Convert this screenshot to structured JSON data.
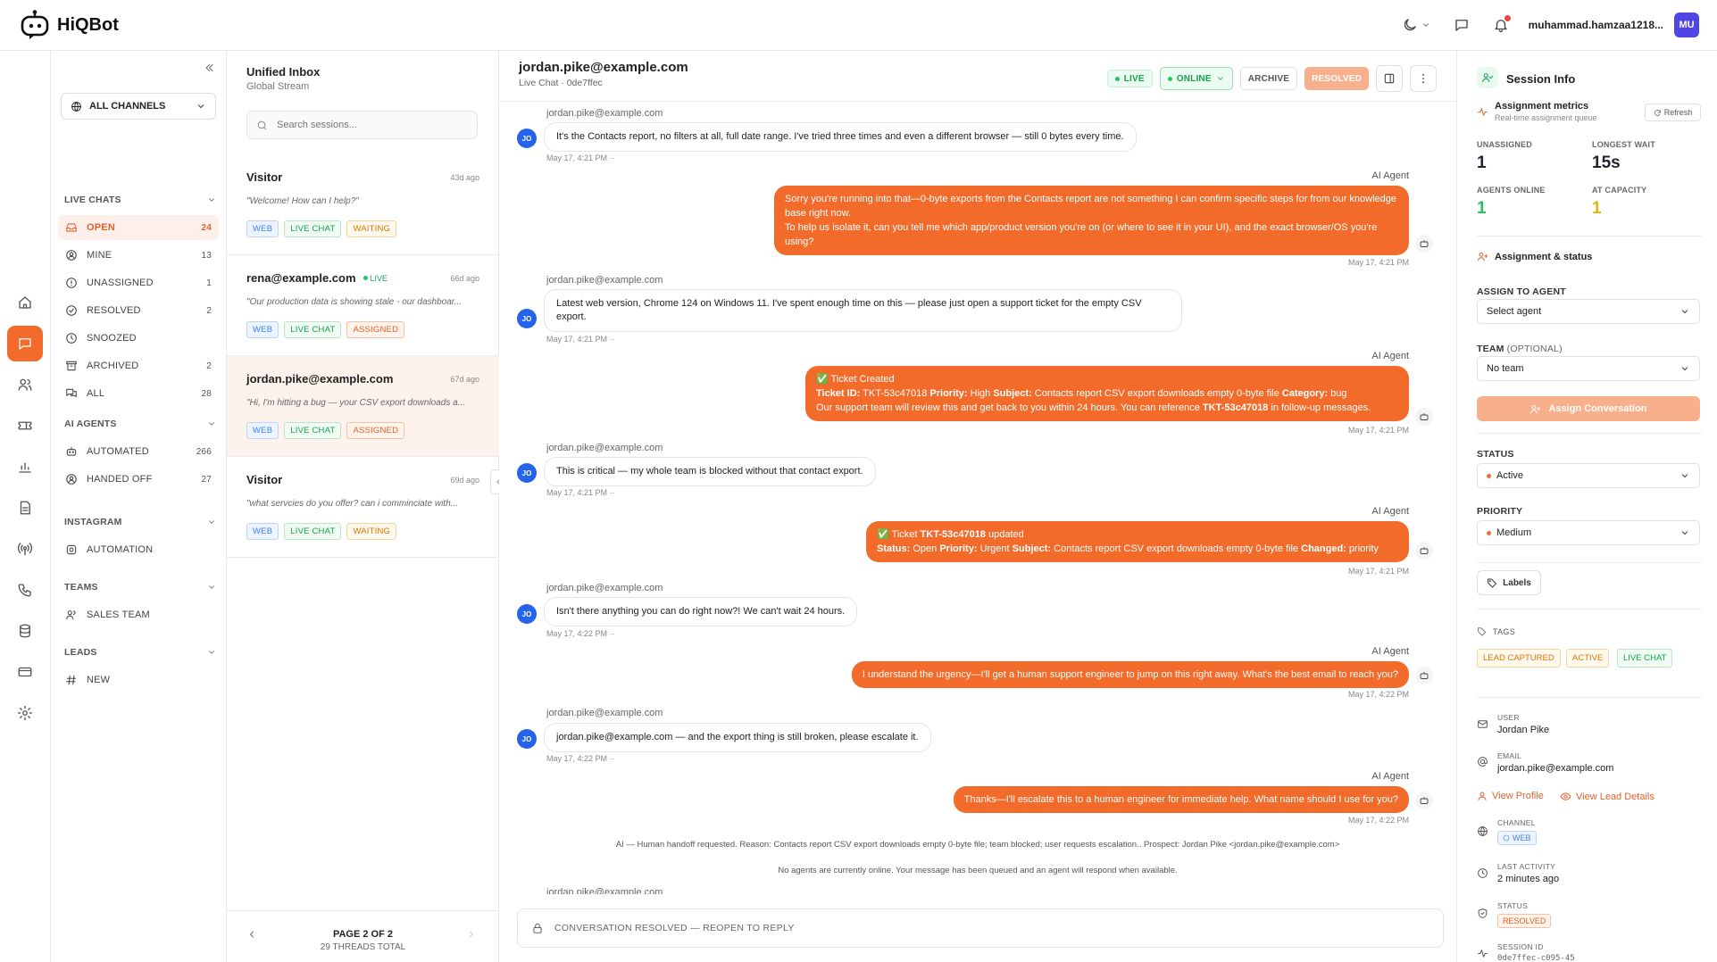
{
  "app": {
    "name": "HiQBot"
  },
  "topbar": {
    "username": "muhammad.hamzaa1218...",
    "avatar_initials": "MU"
  },
  "sidebar": {
    "channel_select": "ALL CHANNELS",
    "sections": {
      "live_chats": "LIVE CHATS",
      "ai_agents": "AI AGENTS",
      "instagram": "INSTAGRAM",
      "teams": "TEAMS",
      "leads": "LEADS"
    },
    "live_chats": [
      {
        "label": "OPEN",
        "count": "24"
      },
      {
        "label": "MINE",
        "count": "13"
      },
      {
        "label": "UNASSIGNED",
        "count": "1"
      },
      {
        "label": "RESOLVED",
        "count": "2"
      },
      {
        "label": "SNOOZED",
        "count": ""
      },
      {
        "label": "ARCHIVED",
        "count": "2"
      },
      {
        "label": "ALL",
        "count": "28"
      }
    ],
    "ai_agents": [
      {
        "label": "AUTOMATED",
        "count": "266"
      },
      {
        "label": "HANDED OFF",
        "count": "27"
      }
    ],
    "instagram": [
      {
        "label": "AUTOMATION"
      }
    ],
    "teams": [
      {
        "label": "SALES TEAM"
      }
    ],
    "leads": [
      {
        "label": "NEW"
      }
    ]
  },
  "threads": {
    "title": "Unified Inbox",
    "subtitle": "Global Stream",
    "search_placeholder": "Search sessions...",
    "items": [
      {
        "name": "Visitor",
        "live": "",
        "time": "43d ago",
        "preview": "\"Welcome! How can I help?\"",
        "badges": [
          "WEB",
          "LIVE CHAT",
          "WAITING"
        ]
      },
      {
        "name": "rena@example.com",
        "live": "LIVE",
        "time": "66d ago",
        "preview": "\"Our production data is showing stale - our dashboar...",
        "badges": [
          "WEB",
          "LIVE CHAT",
          "ASSIGNED"
        ]
      },
      {
        "name": "jordan.pike@example.com",
        "live": "",
        "time": "67d ago",
        "preview": "\"Hi, I'm hitting a bug — your CSV export downloads a...",
        "badges": [
          "WEB",
          "LIVE CHAT",
          "ASSIGNED"
        ]
      },
      {
        "name": "Visitor",
        "live": "",
        "time": "69d ago",
        "preview": "\"what servcies do you offer? can i comminciate with...",
        "badges": [
          "WEB",
          "LIVE CHAT",
          "WAITING"
        ]
      }
    ],
    "pager_page": "PAGE 2 OF 2",
    "pager_total": "29 THREADS TOTAL"
  },
  "conversation": {
    "email": "jordan.pike@example.com",
    "channel": "Live Chat",
    "separator": "·",
    "session_short": "0de7ffec",
    "live_label": "LIVE",
    "online_label": "ONLINE",
    "archive_label": "ARCHIVE",
    "resolved_label": "RESOLVED",
    "avatar_initials": "JO",
    "ai_agent_label": "AI Agent",
    "messages": [
      {
        "sender": "jordan.pike@example.com",
        "text": "It's the Contacts report, no filters at all, full date range. I've tried three times and even a different browser — still 0 bytes every time.",
        "time": "May 17, 4:21 PM ··"
      },
      {
        "text1": "Sorry you're running into that—0-byte exports from the Contacts report are not something I can confirm specific steps for from our knowledge base right now.",
        "text2": "To help us isolate it, can you tell me which app/product version you're on (or where to see it in your UI), and the exact browser/OS you're using?",
        "time": "May 17, 4:21 PM"
      },
      {
        "sender": "jordan.pike@example.com",
        "text": "Latest web version, Chrome 124 on Windows 11. I've spent enough time on this — please just open a support ticket for the empty CSV export.",
        "time": "May 17, 4:21 PM ··"
      },
      {
        "title": "✅ Ticket Created",
        "l_ticket": "Ticket ID:",
        "ticket": "TKT-53c47018",
        "l_priority": "Priority:",
        "priority": "High",
        "l_subject": "Subject:",
        "subject": "Contacts report CSV export downloads empty 0-byte file",
        "l_category": "Category:",
        "category": "bug",
        "body": "Our support team will review this and get back to you within 24 hours. You can reference",
        "ref": "TKT-53c47018",
        "tail": "in follow-up messages.",
        "time": "May 17, 4:21 PM"
      },
      {
        "sender": "jordan.pike@example.com",
        "text": "This is critical — my whole team is blocked without that contact export.",
        "time": "May 17, 4:21 PM ··"
      },
      {
        "title_pre": "✅ Ticket",
        "ticket": "TKT-53c47018",
        "title_post": "updated",
        "l_status": "Status:",
        "status": "Open",
        "l_priority": "Priority:",
        "priority": "Urgent",
        "l_subject": "Subject:",
        "subject": "Contacts report CSV export downloads empty 0-byte file",
        "l_changed": "Changed:",
        "changed": "priority",
        "time": "May 17, 4:21 PM"
      },
      {
        "sender": "jordan.pike@example.com",
        "text": "Isn't there anything you can do right now?! We can't wait 24 hours.",
        "time": "May 17, 4:22 PM ··"
      },
      {
        "text": "I understand the urgency—I'll get a human support engineer to jump on this right away. What's the best email to reach you?",
        "time": "May 17, 4:22 PM"
      },
      {
        "sender": "jordan.pike@example.com",
        "text": "jordan.pike@example.com — and the export thing is still broken, please escalate it.",
        "time": "May 17, 4:22 PM ··"
      },
      {
        "text": "Thanks—I'll escalate this to a human engineer for immediate help. What name should I use for you?",
        "time": "May 17, 4:22 PM"
      }
    ],
    "system_1": "AI — Human handoff requested. Reason: Contacts report CSV export downloads empty 0-byte file; team blocked; user requests escalation.. Prospect: Jordan Pike <jordan.pike@example.com>",
    "system_2": "No agents are currently online. Your message has been queued and an agent will respond when available.",
    "partial_sender": "jordan.pike@example.com",
    "resolved_bar": "CONVERSATION RESOLVED — REOPEN TO REPLY"
  },
  "info": {
    "title": "Session Info",
    "metrics_title": "Assignment metrics",
    "metrics_sub": "Real-time assignment queue",
    "refresh": "Refresh",
    "metrics": [
      {
        "label": "UNASSIGNED",
        "value": "1",
        "color": "#1f2430"
      },
      {
        "label": "LONGEST WAIT",
        "value": "15s",
        "color": "#1f2430"
      },
      {
        "label": "AGENTS ONLINE",
        "value": "1",
        "color": "#22c55e"
      },
      {
        "label": "AT CAPACITY",
        "value": "1",
        "color": "#eab308"
      }
    ],
    "assign_title": "Assignment & status",
    "assign_to_label": "ASSIGN TO AGENT",
    "agent_placeholder": "Select agent",
    "team_label": "TEAM",
    "team_optional": "(OPTIONAL)",
    "team_value": "No team",
    "assign_button": "Assign Conversation",
    "status_label": "STATUS",
    "status_value": "Active",
    "priority_label": "PRIORITY",
    "priority_value": "Medium",
    "labels_button": "Labels",
    "tags_label": "TAGS",
    "tags": [
      "LEAD CAPTURED",
      "ACTIVE",
      "LIVE CHAT"
    ],
    "user_label": "USER",
    "user_value": "Jordan Pike",
    "email_label": "EMAIL",
    "email_value": "jordan.pike@example.com",
    "view_profile": "View Profile",
    "view_lead": "View Lead Details",
    "channel_label": "CHANNEL",
    "channel_value": "WEB",
    "last_activity_label": "LAST ACTIVITY",
    "last_activity_value": "2 minutes ago",
    "status2_label": "STATUS",
    "status2_value": "RESOLVED",
    "session_id_label": "SESSION ID",
    "session_id_value": "0de7ffec-c095-45"
  },
  "colors": {
    "accent": "#f26b2a",
    "accent_light": "#f8b08c",
    "green": "#22c55e",
    "avatar": "#4f46e5"
  }
}
